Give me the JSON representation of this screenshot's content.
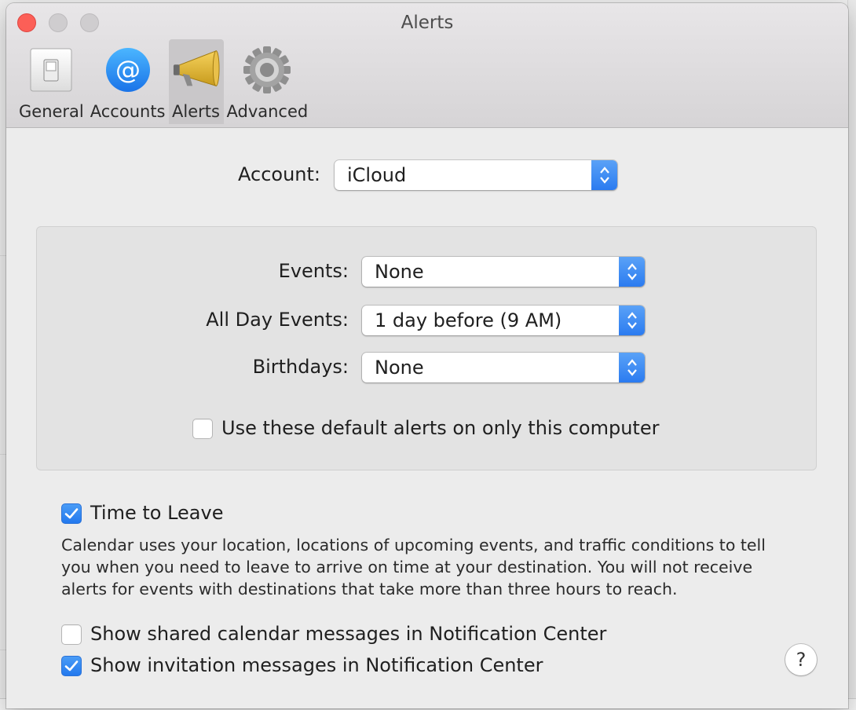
{
  "window": {
    "title": "Alerts"
  },
  "toolbar": {
    "tabs": [
      {
        "label": "General",
        "icon": "switch-icon",
        "active": false
      },
      {
        "label": "Accounts",
        "icon": "at-sign-icon",
        "active": false
      },
      {
        "label": "Alerts",
        "icon": "megaphone-icon",
        "active": true
      },
      {
        "label": "Advanced",
        "icon": "gear-icon",
        "active": false
      }
    ]
  },
  "account": {
    "label": "Account:",
    "value": "iCloud"
  },
  "defaults": {
    "events_label": "Events:",
    "events_value": "None",
    "all_day_label": "All Day Events:",
    "all_day_value": "1 day before (9 AM)",
    "birthdays_label": "Birthdays:",
    "birthdays_value": "None",
    "only_this_computer": {
      "label": "Use these default alerts on only this computer",
      "checked": false
    }
  },
  "time_to_leave": {
    "label": "Time to Leave",
    "checked": true,
    "description": "Calendar uses your location, locations of upcoming events, and traffic conditions to tell you when you need to leave to arrive on time at your destination. You will not receive alerts for events with destinations that take more than three hours to reach."
  },
  "notifications": {
    "shared": {
      "label": "Show shared calendar messages in Notification Center",
      "checked": false
    },
    "invitations": {
      "label": "Show invitation messages in Notification Center",
      "checked": true
    }
  },
  "help": {
    "label": "?"
  },
  "colors": {
    "accent": "#2b7bf0",
    "close": "#fc5f57"
  }
}
